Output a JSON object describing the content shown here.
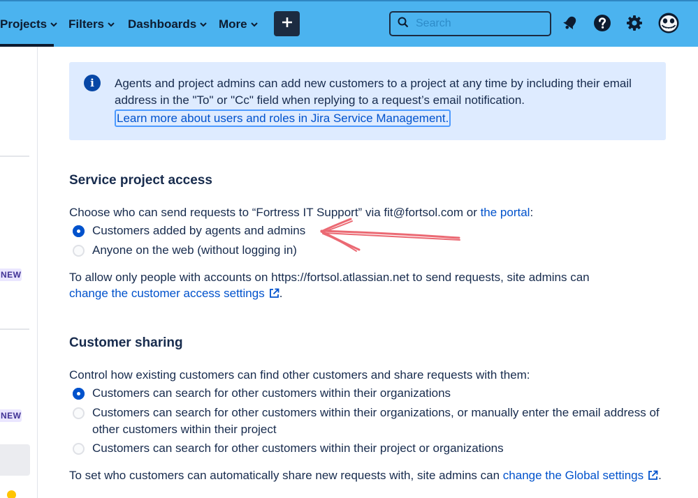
{
  "nav": {
    "items": [
      {
        "label": "Projects"
      },
      {
        "label": "Filters"
      },
      {
        "label": "Dashboards"
      },
      {
        "label": "More"
      }
    ],
    "search_placeholder": "Search",
    "colors": {
      "bar": "#4bb3ef",
      "dark": "#1c2b41"
    }
  },
  "sidebar": {
    "badges": [
      "NEW",
      "NEW"
    ]
  },
  "banner": {
    "text": "Agents and project admins can add new customers to a project at any time by including their email address in the \"To\" or \"Cc\" field when replying to a request’s email notification.",
    "link": "Learn more about users and roles in Jira Service Management."
  },
  "access": {
    "heading": "Service project access",
    "intro_prefix": "Choose who can send requests to “Fortress IT Support” via fit@fortsol.com or ",
    "intro_link": "the portal",
    "intro_suffix": ":",
    "options": [
      {
        "label": "Customers added by agents and admins",
        "selected": true
      },
      {
        "label": "Anyone on the web (without logging in)",
        "selected": false
      }
    ],
    "note_line1": "To allow only people with accounts on https://fortsol.atlassian.net to send requests, site admins can",
    "note_link": "change the customer access settings",
    "note_suffix": "."
  },
  "sharing": {
    "heading": "Customer sharing",
    "intro": "Control how existing customers can find other customers and share requests with them:",
    "options": [
      {
        "label": "Customers can search for other customers within their organizations",
        "selected": true
      },
      {
        "label": "Customers can search for other customers within their organizations, or manually enter the email address of",
        "label_line2": "other customers within their project",
        "selected": false
      },
      {
        "label": "Customers can search for other customers within their project or organizations",
        "selected": false
      }
    ],
    "note_prefix": "To set who customers can automatically share new requests with, site admins can ",
    "note_link": "change the Global settings",
    "note_suffix": "."
  },
  "annotation": {
    "arrow_color": "#e8505b"
  }
}
